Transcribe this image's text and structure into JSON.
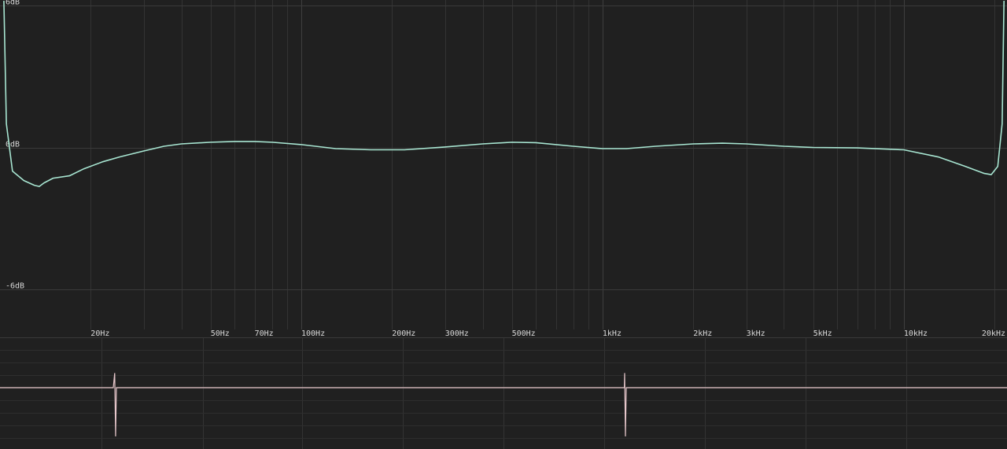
{
  "chart_data": [
    {
      "type": "line",
      "x_scale": "log",
      "xlim": [
        10,
        22000
      ],
      "ylim": [
        -8,
        6
      ],
      "grid": true,
      "y_ticks": [
        {
          "value": 6,
          "label": "6dB"
        },
        {
          "value": 0,
          "label": "0dB"
        },
        {
          "value": -6,
          "label": "-6dB"
        }
      ],
      "x_ticks": [
        {
          "value": 20,
          "label": "20Hz"
        },
        {
          "value": 50,
          "label": "50Hz"
        },
        {
          "value": 70,
          "label": "70Hz"
        },
        {
          "value": 100,
          "label": "100Hz"
        },
        {
          "value": 200,
          "label": "200Hz"
        },
        {
          "value": 300,
          "label": "300Hz"
        },
        {
          "value": 500,
          "label": "500Hz"
        },
        {
          "value": 1000,
          "label": "1kHz"
        },
        {
          "value": 2000,
          "label": "2kHz"
        },
        {
          "value": 3000,
          "label": "3kHz"
        },
        {
          "value": 5000,
          "label": "5kHz"
        },
        {
          "value": 10000,
          "label": "10kHz"
        },
        {
          "value": 20000,
          "label": "20kHz"
        }
      ],
      "series": [
        {
          "color": "#a8e6d2",
          "points": [
            [
              10.3,
              6.2
            ],
            [
              10.5,
              1.0
            ],
            [
              11,
              -1.0
            ],
            [
              12,
              -1.4
            ],
            [
              13,
              -1.6
            ],
            [
              13.5,
              -1.65
            ],
            [
              14,
              -1.5
            ],
            [
              15,
              -1.3
            ],
            [
              17,
              -1.2
            ],
            [
              19,
              -0.9
            ],
            [
              22,
              -0.6
            ],
            [
              25,
              -0.4
            ],
            [
              30,
              -0.15
            ],
            [
              35,
              0.05
            ],
            [
              40,
              0.15
            ],
            [
              50,
              0.22
            ],
            [
              60,
              0.25
            ],
            [
              70,
              0.25
            ],
            [
              80,
              0.22
            ],
            [
              100,
              0.12
            ],
            [
              130,
              -0.05
            ],
            [
              170,
              -0.1
            ],
            [
              220,
              -0.1
            ],
            [
              300,
              0.02
            ],
            [
              400,
              0.15
            ],
            [
              500,
              0.22
            ],
            [
              600,
              0.2
            ],
            [
              800,
              0.05
            ],
            [
              1000,
              -0.05
            ],
            [
              1200,
              -0.05
            ],
            [
              1500,
              0.05
            ],
            [
              2000,
              0.15
            ],
            [
              2500,
              0.18
            ],
            [
              3000,
              0.15
            ],
            [
              4000,
              0.05
            ],
            [
              5000,
              0.0
            ],
            [
              7000,
              -0.02
            ],
            [
              10000,
              -0.1
            ],
            [
              13000,
              -0.4
            ],
            [
              16000,
              -0.8
            ],
            [
              18500,
              -1.1
            ],
            [
              19500,
              -1.15
            ],
            [
              20500,
              -0.8
            ],
            [
              21200,
              1.0
            ],
            [
              21500,
              6.2
            ]
          ]
        }
      ]
    },
    {
      "type": "line",
      "grid": true,
      "ylim": [
        -1,
        1
      ],
      "series": [
        {
          "color": "#e8c8cc",
          "points": [
            [
              0,
              0
            ],
            [
              0.1125,
              0
            ],
            [
              0.1139,
              0.6
            ],
            [
              0.1148,
              -2.0
            ],
            [
              0.1156,
              0
            ],
            [
              0.62,
              0
            ],
            [
              0.6203,
              0.6
            ],
            [
              0.6211,
              -2.0
            ],
            [
              0.6219,
              0
            ],
            [
              1,
              0
            ]
          ]
        }
      ]
    }
  ]
}
